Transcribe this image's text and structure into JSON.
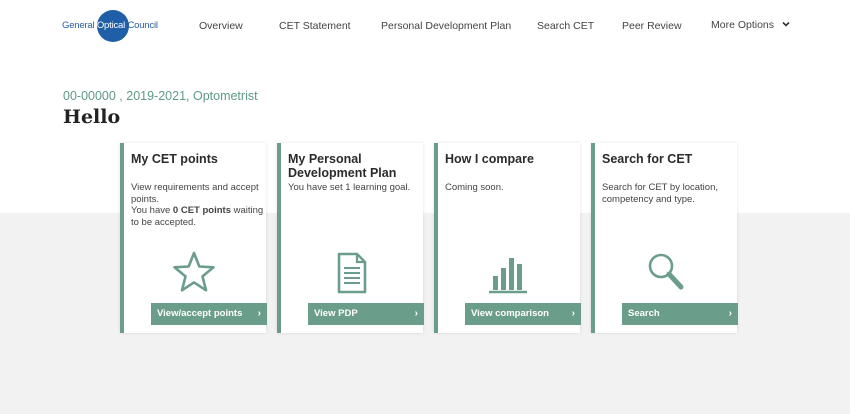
{
  "header": {
    "logo": {
      "text_before": "General",
      "text_mid": "Optical",
      "text_after": "Council"
    },
    "nav": [
      {
        "label": "Overview"
      },
      {
        "label": "CET Statement"
      },
      {
        "label": "Personal Development Plan"
      },
      {
        "label": "Search CET"
      },
      {
        "label": "Peer Review"
      },
      {
        "label": "More Options"
      }
    ]
  },
  "page": {
    "subtitle": "00-00000 , 2019-2021, Optometrist",
    "greeting": "Hello"
  },
  "cards": [
    {
      "title": "My CET points",
      "desc_line1": "View requirements and accept points.",
      "desc_pre": "You have ",
      "desc_bold": "0 CET points",
      "desc_post": " waiting to be accepted.",
      "icon": "star-icon",
      "button": "View/accept points",
      "arrow": "›"
    },
    {
      "title": "My Personal Development Plan",
      "desc": "You have set 1 learning goal.",
      "icon": "document-icon",
      "button": "View PDP",
      "arrow": "›"
    },
    {
      "title": "How I compare",
      "desc": "Coming soon.",
      "icon": "bar-chart-icon",
      "button": "View comparison",
      "arrow": "›"
    },
    {
      "title": "Search for CET",
      "desc": "Search for CET by location, competency and type.",
      "icon": "magnifier-icon",
      "button": "Search",
      "arrow": "›"
    }
  ],
  "colors": {
    "accent": "#6b9e8a",
    "brand": "#1f5fa8",
    "band": "#f2f2f2"
  }
}
